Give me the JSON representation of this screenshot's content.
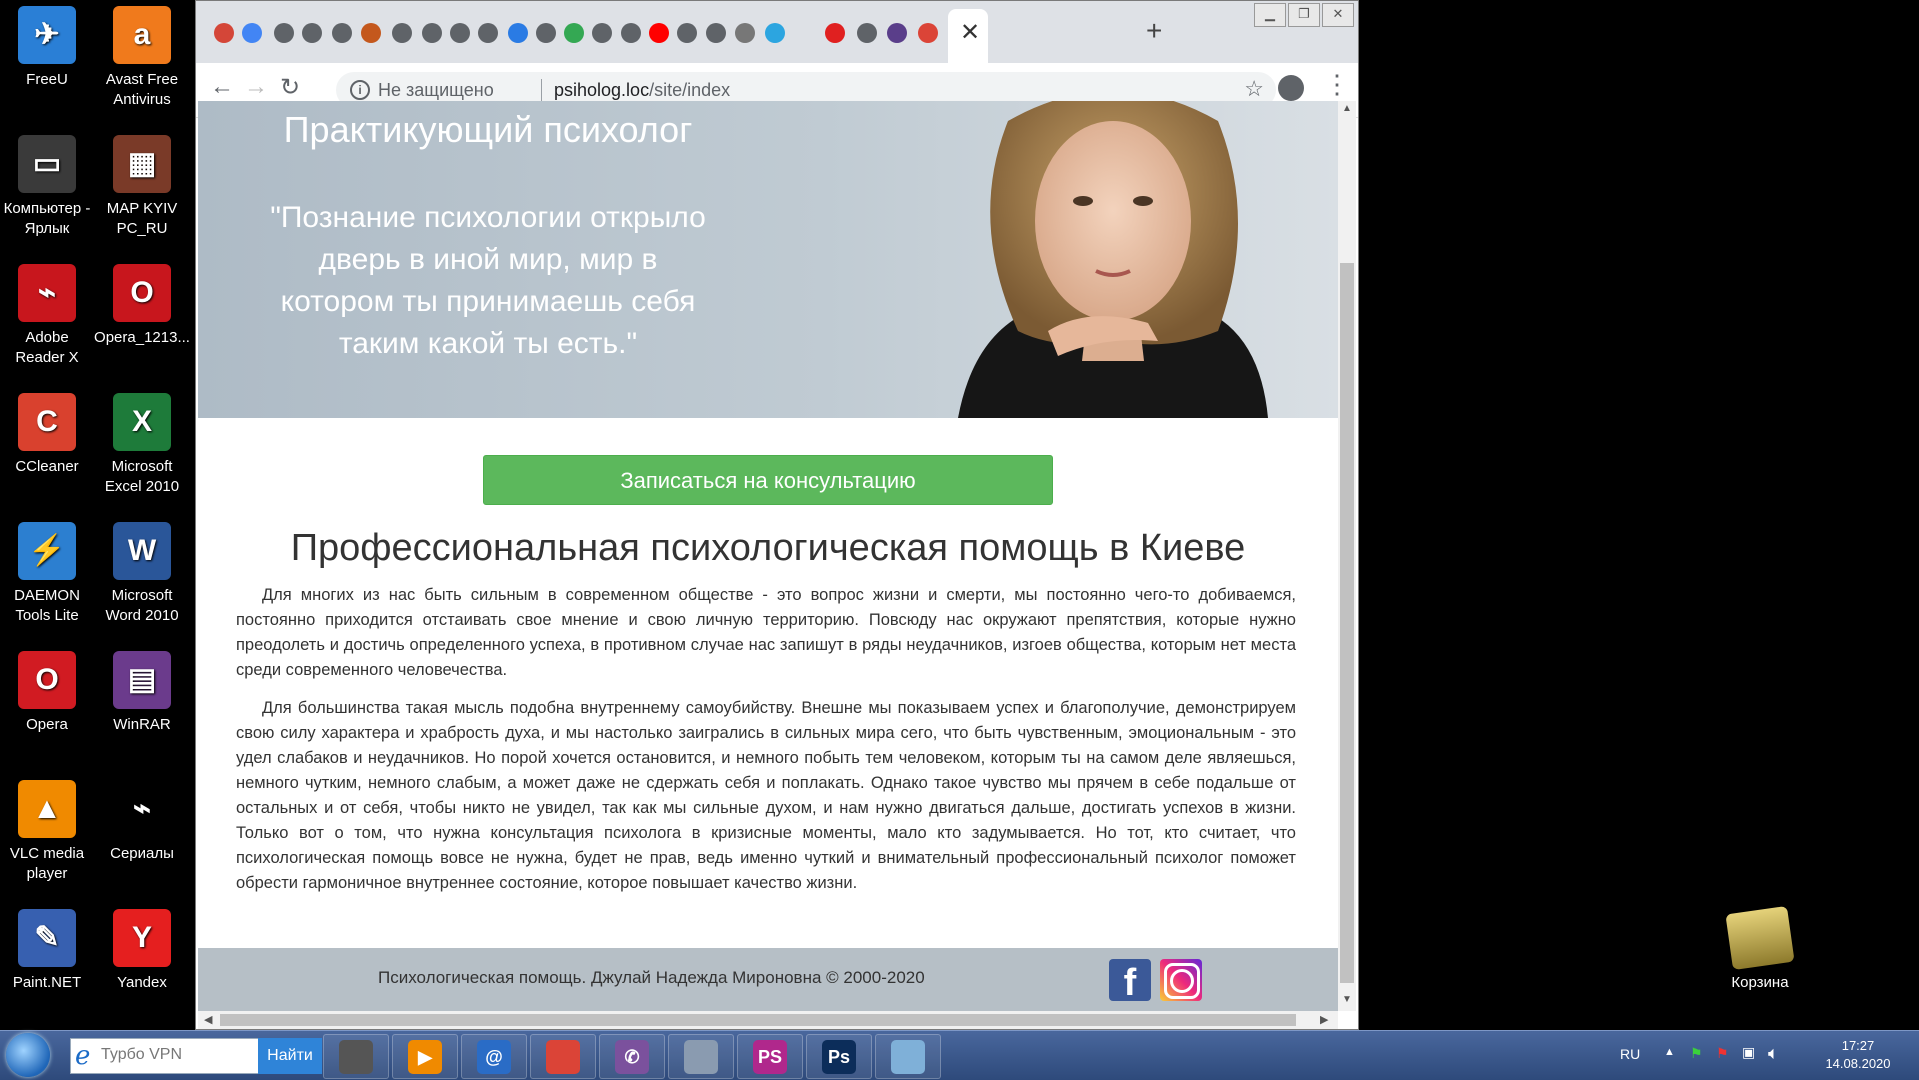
{
  "desktop": {
    "icons": [
      {
        "label": "FreeU",
        "color": "#2a7fd6"
      },
      {
        "label": "Avast Free Antivirus",
        "color": "#f07a1c"
      },
      {
        "label": "Компьютер - Ярлык",
        "color": "#3a3a3a"
      },
      {
        "label": "MAP KYIV PC_RU",
        "color": "#7a3a28"
      },
      {
        "label": "Adobe Reader X",
        "color": "#c8161d"
      },
      {
        "label": "Opera_1213...",
        "color": "#c8161d"
      },
      {
        "label": "CCleaner",
        "color": "#d9412e"
      },
      {
        "label": "Microsoft Excel 2010",
        "color": "#1e7b3a"
      },
      {
        "label": "DAEMON Tools Lite",
        "color": "#2c7fd0"
      },
      {
        "label": "Microsoft Word 2010",
        "color": "#2a5699"
      },
      {
        "label": "Opera",
        "color": "#d11b22"
      },
      {
        "label": "WinRAR",
        "color": "#6b3b8c"
      },
      {
        "label": "VLC media player",
        "color": "#f08a00"
      },
      {
        "label": "Сериалы",
        "color": "#000000"
      },
      {
        "label": "Paint.NET",
        "color": "#3760b0"
      },
      {
        "label": "Yandex",
        "color": "#e51f1f"
      }
    ],
    "recycle_bin": "Корзина"
  },
  "browser": {
    "address_security": "Не защищено",
    "address_host": "psiholog.loc",
    "address_path": "/site/index",
    "tab_close": "✕",
    "new_tab": "+",
    "back": "←",
    "forward": "→",
    "reload": "↻",
    "star": "☆",
    "menu": "⋮"
  },
  "page": {
    "hero_title": "Практикующий психолог",
    "hero_quote": "\"Познание психологии открыло дверь в иной мир, мир в котором ты принимаешь себя таким какой ты есть.\"",
    "cta_label": "Записаться на консультацию",
    "headline": "Профессиональная психологическая помощь в Киеве",
    "para1": "Для многих из нас быть сильным в современном обществе - это вопрос жизни и смерти, мы постоянно чего-то добиваемся, постоянно приходится отстаивать свое мнение и свою личную территорию. Повсюду нас окружают препятствия, которые нужно преодолеть и достичь определенного успеха, в противном случае нас запишут в ряды неудачников, изгоев общества, которым нет места среди современного человечества.",
    "para2": "Для большинства такая мысль подобна внутреннему самоубийству. Внешне мы показываем успех и благополучие, демонстрируем свою силу характера и храбрость духа, и мы настолько заигрались в сильных мира сего, что быть чувственным, эмоциональным - это удел слабаков и неудачников. Но порой хочется остановится, и немного побыть тем человеком, которым ты на самом деле являешься, немного чутким, немного слабым, а может даже не сдержать себя и поплакать. Однако такое чувство мы прячем в себе подальше от остальных и от себя, чтобы никто не увидел, так как мы сильные духом, и нам нужно двигаться дальше, достигать успехов в жизни. Только вот о том, что нужна консультация психолога в кризисные моменты, мало кто задумывается. Но тот, кто считает, что психологическая помощь вовсе не нужна, будет не прав, ведь именно чуткий и внимательный профессиональный психолог поможет обрести гармоничное внутреннее состояние, которое повышает качество жизни.",
    "footer_text": "Психологическая помощь. Джулай Надежда Мироновна © 2000-2020",
    "facebook_glyph": "f"
  },
  "taskbar": {
    "search_placeholder": "Турбо VPN",
    "find_button": "Найти",
    "apps": [
      {
        "name": "printer",
        "label": "",
        "color": "#555555"
      },
      {
        "name": "media-player",
        "label": "▶",
        "color": "#f08a00"
      },
      {
        "name": "mail",
        "label": "@",
        "color": "#2a6cc6"
      },
      {
        "name": "chrome",
        "label": "",
        "color": "#db4437"
      },
      {
        "name": "viber",
        "label": "✆",
        "color": "#7b519d"
      },
      {
        "name": "calculator",
        "label": "",
        "color": "#8a9bb0"
      },
      {
        "name": "phpstorm",
        "label": "PS",
        "color": "#b0288c"
      },
      {
        "name": "photoshop",
        "label": "Ps",
        "color": "#0c2d5a"
      },
      {
        "name": "notes",
        "label": "",
        "color": "#7fb0d8"
      }
    ],
    "language": "RU",
    "time": "17:27",
    "date": "14.08.2020"
  }
}
